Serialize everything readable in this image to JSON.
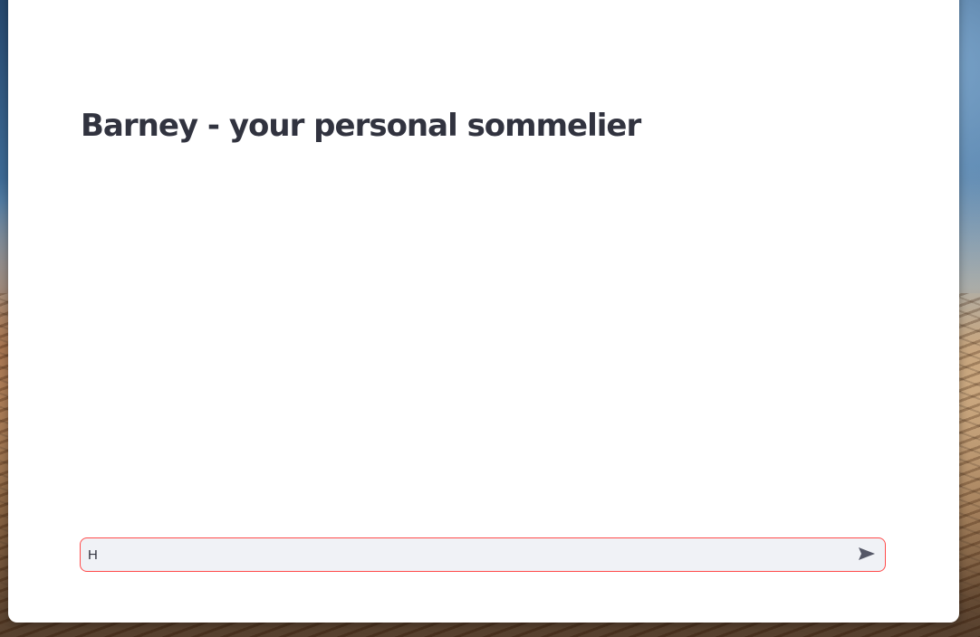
{
  "app": {
    "title": "Barney - your personal sommelier"
  },
  "chat": {
    "input_value": "H",
    "send_icon": "send-icon",
    "accent_color": "#ff4b4b"
  }
}
